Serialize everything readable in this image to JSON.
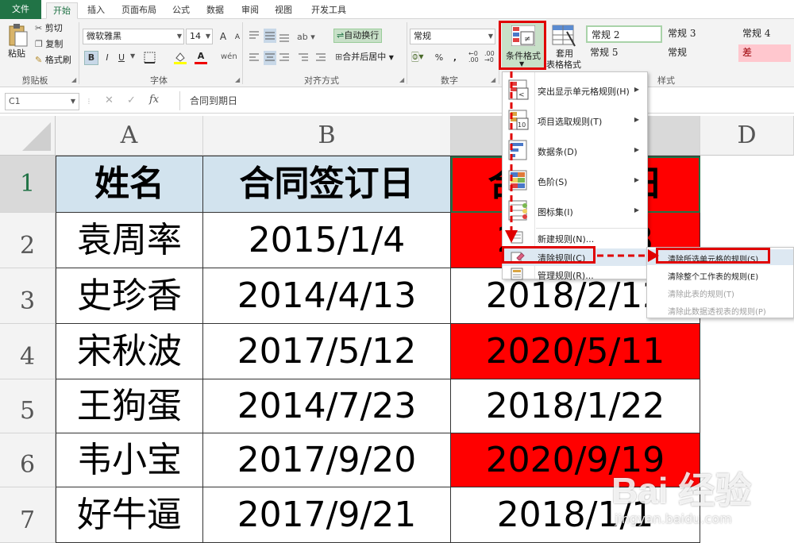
{
  "tabs": [
    "文件",
    "开始",
    "插入",
    "页面布局",
    "公式",
    "数据",
    "审阅",
    "视图",
    "开发工具"
  ],
  "clipboard": {
    "paste": "粘贴",
    "cut": "剪切",
    "copy": "复制",
    "format_painter": "格式刷",
    "label": "剪贴板"
  },
  "font": {
    "name": "微软雅黑",
    "size": "14",
    "bold": "B",
    "italic": "I",
    "underline": "U",
    "label": "字体",
    "grow": "A",
    "shrink": "A"
  },
  "alignment": {
    "wrap_text": "自动换行",
    "merge_center": "合并后居中",
    "label": "对齐方式"
  },
  "number": {
    "format": "常规",
    "percent": "%",
    "comma": ",",
    "label": "数字"
  },
  "styles": {
    "conditional_formatting": "条件格式",
    "format_as_table_1": "套用",
    "format_as_table_2": "表格格式",
    "cells": [
      "常规 2",
      "常规 3",
      "常规 4",
      "常规 5",
      "常规",
      "差"
    ],
    "label": "样式"
  },
  "formula_bar": {
    "name_box": "C1",
    "fx": "fx",
    "content": "合同到期日"
  },
  "columns": [
    "A",
    "B",
    "C",
    "D"
  ],
  "rows": [
    "1",
    "2",
    "3",
    "4",
    "5",
    "6",
    "7"
  ],
  "table": {
    "headers": [
      "姓名",
      "合同签订日",
      "合同到期日"
    ],
    "rows": [
      [
        "袁周率",
        "2015/1/4",
        "2018/1/3"
      ],
      [
        "史珍香",
        "2014/4/13",
        "2018/2/12"
      ],
      [
        "宋秋波",
        "2017/5/12",
        "2020/5/11"
      ],
      [
        "王狗蛋",
        "2014/7/23",
        "2018/1/22"
      ],
      [
        "韦小宝",
        "2017/9/20",
        "2020/9/19"
      ],
      [
        "好牛逼",
        "2017/9/21",
        "2018/1/1"
      ]
    ],
    "highlight_color": "#ff0000"
  },
  "cf_menu": {
    "items": [
      "突出显示单元格规则(H)",
      "项目选取规则(T)",
      "数据条(D)",
      "色阶(S)",
      "图标集(I)",
      "新建规则(N)...",
      "清除规则(C)",
      "管理规则(R)..."
    ]
  },
  "clear_submenu": {
    "items": [
      "清除所选单元格的规则(S)",
      "清除整个工作表的规则(E)",
      "清除此表的规则(T)",
      "清除此数据透视表的规则(P)"
    ]
  },
  "watermark": {
    "brand": "Bai 经验",
    "url": "jingyan.baidu.com"
  },
  "colors": {
    "excel_green": "#217346",
    "header_fill": "#d2e3ee",
    "annotation_red": "#e00000"
  }
}
